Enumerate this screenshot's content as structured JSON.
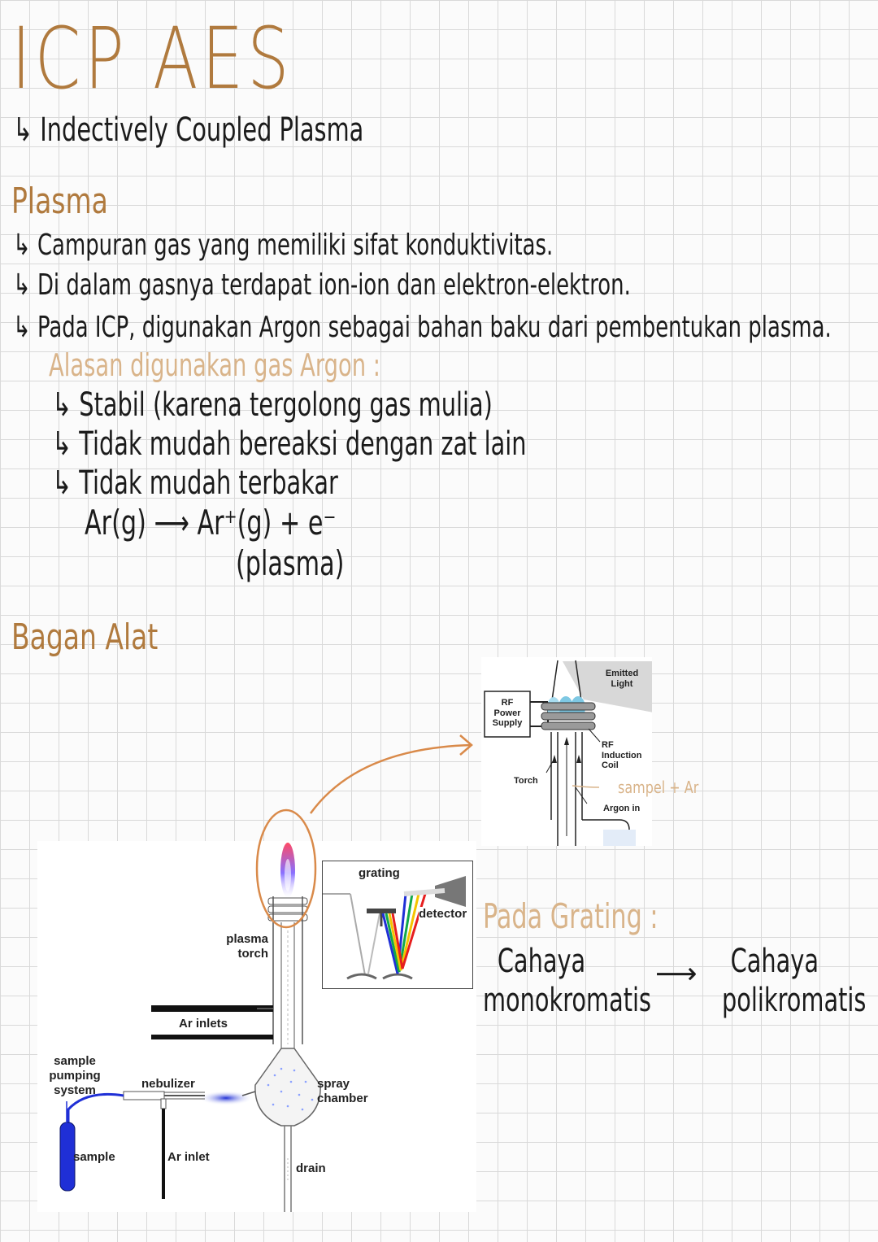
{
  "title": "ICP AES",
  "subtitle": "↳ Indectively Coupled Plasma",
  "plasma": {
    "heading": "Plasma",
    "points": [
      "↳ Campuran gas yang memiliki sifat konduktivitas.",
      "↳ Di dalam gasnya terdapat ion-ion dan elektron-elektron.",
      "↳ Pada ICP, digunakan Argon sebagai bahan baku dari pembentukan plasma."
    ],
    "argon_heading": "Alasan digunakan gas Argon :",
    "argon_reasons": [
      "↳ Stabil (karena tergolong gas mulia)",
      "↳ Tidak mudah bereaksi dengan zat lain",
      "↳ Tidak mudah terbakar"
    ],
    "equation": "Ar(g)  ⟶  Ar⁺(g) + e⁻",
    "equation_note": "(plasma)"
  },
  "bagan": {
    "heading": "Bagan Alat",
    "torch_detail": {
      "rf_power_supply": "RF Power Supply",
      "emitted_light": "Emitted Light",
      "rf_induction_coil": "RF Induction Coil",
      "torch": "Torch",
      "argon_in": "Argon in",
      "annotation": "sampel + Ar"
    },
    "spectrometer": {
      "grating": "grating",
      "detector": "detector"
    },
    "apparatus": {
      "plasma_torch": "plasma torch",
      "ar_inlets": "Ar inlets",
      "sample_pumping_system": "sample pumping system",
      "nebulizer": "nebulizer",
      "spray_chamber": "spray chamber",
      "sample": "sample",
      "ar_inlet": "Ar inlet",
      "drain": "drain"
    }
  },
  "grating_note": {
    "heading": "Pada Grating :",
    "from": "Cahaya monokromatis",
    "arrow": "⟶",
    "to": "Cahaya polikromatis"
  },
  "colors": {
    "brown": "#b07a3e",
    "tan": "#d9b48a",
    "grid": "#d9d9d9",
    "blue": "#1f2fd6"
  }
}
